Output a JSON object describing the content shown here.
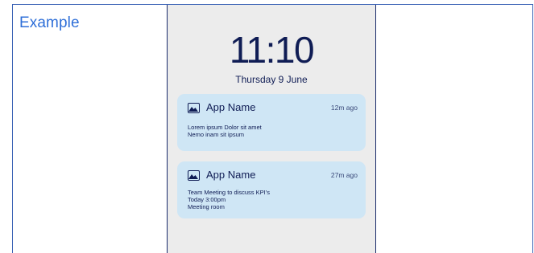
{
  "page": {
    "title": "Example"
  },
  "lockscreen": {
    "time": "11:10",
    "date": "Thursday 9 June"
  },
  "notifications": [
    {
      "icon": "image-icon",
      "app_name": "App Name",
      "timestamp": "12m ago",
      "lines": [
        "Lorem ipsum Dolor sit amet",
        "Nemo inam sit ipsum"
      ]
    },
    {
      "icon": "image-icon",
      "app_name": "App Name",
      "timestamp": "27m ago",
      "lines": [
        "Team Meeting to discuss KPI’s",
        "Today 3:00pm",
        "Meeting room"
      ]
    }
  ],
  "colors": {
    "accent": "#2f6fd8",
    "border": "#3a62b5",
    "phone_bg": "#ececec",
    "card_bg": "#cfe6f5",
    "text_dark": "#0f1c54"
  }
}
